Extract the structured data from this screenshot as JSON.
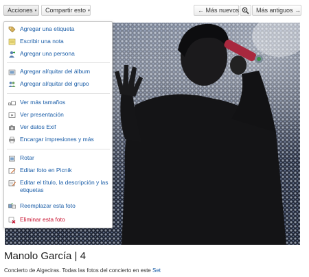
{
  "toolbar": {
    "actions_label": "Acciones",
    "share_label": "Compartir esto",
    "newer_label": "Más nuevos",
    "zoom_icon": "magnifier-icon",
    "older_label": "Más antiguos",
    "caret_glyph": "▾",
    "left_arrow": "←",
    "right_arrow": "→"
  },
  "menu": {
    "items": [
      {
        "label": "Agregar una etiqueta",
        "icon": "tag-add-icon"
      },
      {
        "label": "Escribir una nota",
        "icon": "note-icon"
      },
      {
        "label": "Agregar una persona",
        "icon": "person-add-icon"
      },
      {
        "label": "Agregar al/quitar del álbum",
        "icon": "album-icon"
      },
      {
        "label": "Agregar al/quitar del grupo",
        "icon": "group-icon"
      },
      {
        "label": "Ver más tamaños",
        "icon": "sizes-icon"
      },
      {
        "label": "Ver presentación",
        "icon": "slideshow-icon"
      },
      {
        "label": "Ver datos Exif",
        "icon": "camera-icon"
      },
      {
        "label": "Encargar impresiones y más",
        "icon": "print-icon"
      },
      {
        "label": "Rotar",
        "icon": "rotate-icon"
      },
      {
        "label": "Editar foto en Picnik",
        "icon": "edit-photo-icon"
      },
      {
        "label": "Editar el título, la descripción y las etiquetas",
        "icon": "edit-text-icon"
      },
      {
        "label": "Reemplazar esta foto",
        "icon": "replace-icon"
      },
      {
        "label": "Eliminar esta foto",
        "icon": "delete-icon"
      }
    ]
  },
  "photo": {
    "title": "Manolo García | 4",
    "caption": "Concierto de Algeciras. Todas las fotos del concierto en este",
    "caption_link": "Set"
  },
  "colors": {
    "link": "#1b5ea8",
    "delete": "#c8102e",
    "menu_border": "#c8c8c8"
  }
}
